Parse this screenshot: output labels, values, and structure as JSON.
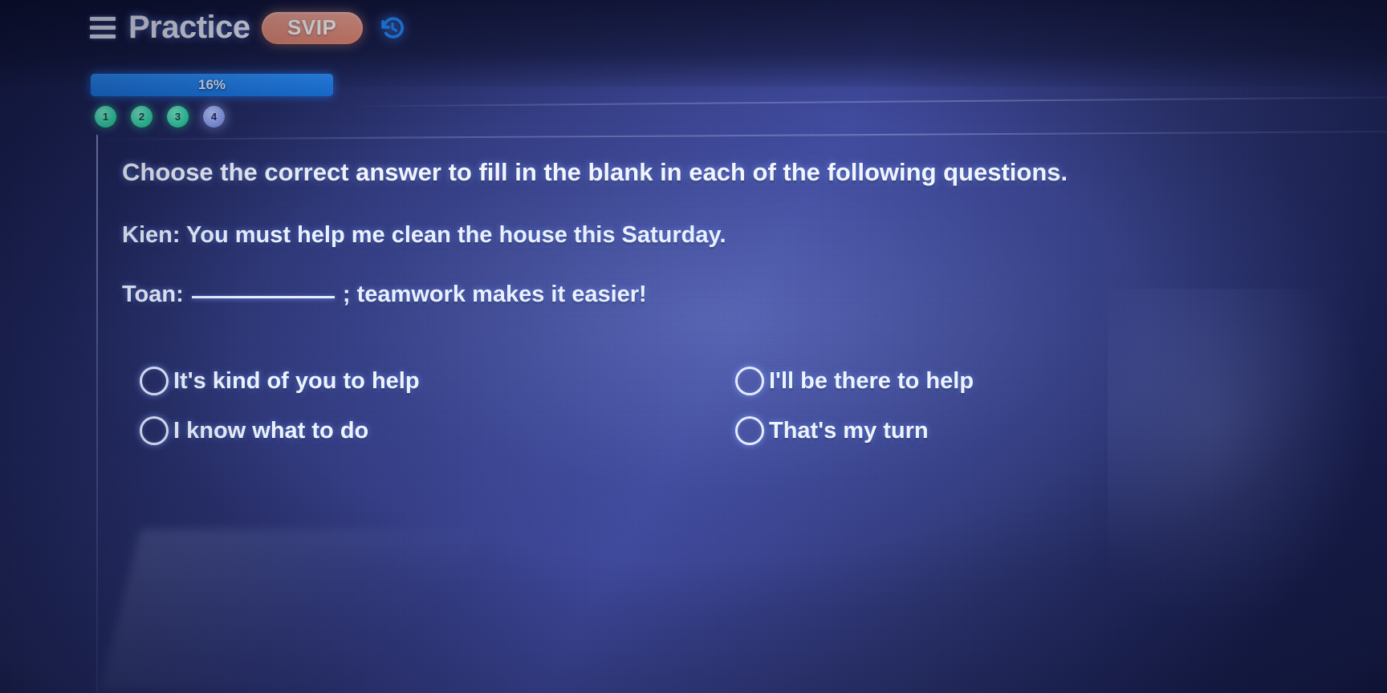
{
  "header": {
    "menu_icon": "hamburger-menu-icon",
    "title": "Practice",
    "badge_label": "SVIP",
    "refresh_icon": "refresh-history-icon"
  },
  "progress": {
    "percent_label": "16%",
    "percent_value": 16
  },
  "pager": {
    "items": [
      {
        "number": "1",
        "state": "done"
      },
      {
        "number": "2",
        "state": "done"
      },
      {
        "number": "3",
        "state": "done"
      },
      {
        "number": "4",
        "state": "current"
      }
    ]
  },
  "question": {
    "instruction": "Choose the correct answer to fill in the blank in each of the following questions.",
    "line1": "Kien: You must help me clean the house this Saturday.",
    "line2_prefix": "Toan:",
    "line2_suffix": "; teamwork makes it easier!"
  },
  "options": [
    {
      "id": "option-a",
      "label": "It's kind of you to help",
      "selected": false
    },
    {
      "id": "option-b",
      "label": "I'll be there to help",
      "selected": false
    },
    {
      "id": "option-c",
      "label": "I know what to do",
      "selected": false
    },
    {
      "id": "option-d",
      "label": "That's my turn",
      "selected": false
    }
  ],
  "colors": {
    "background_navy": "#232a60",
    "accent_blue": "#1d79e8",
    "badge_coral": "#e8917c",
    "pager_done_green": "#35d6a8",
    "pager_current_blue": "#8fa4f0",
    "text_white": "#eef2ff"
  }
}
